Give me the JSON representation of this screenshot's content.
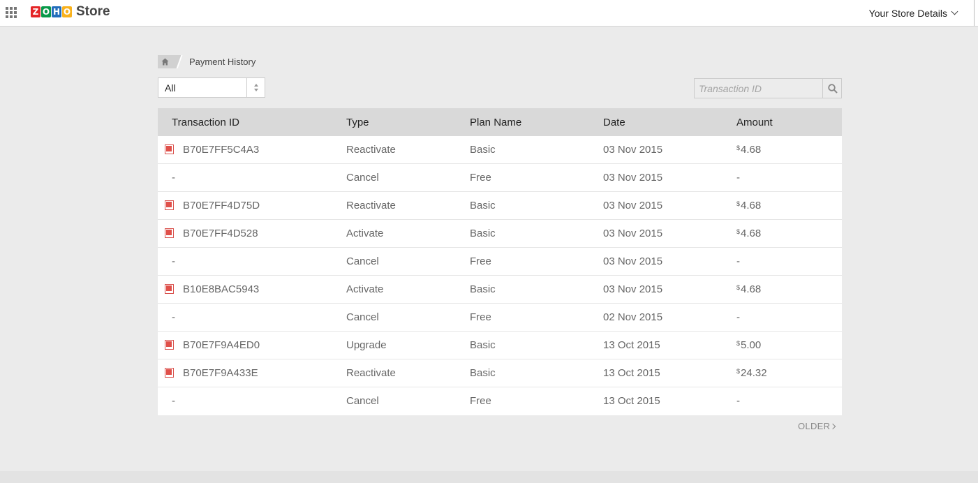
{
  "header": {
    "logo_letters": [
      "Z",
      "O",
      "H",
      "O"
    ],
    "logo_colors": [
      "#e42527",
      "#089949",
      "#226dbb",
      "#f9b21d"
    ],
    "app_name": "Store",
    "store_menu_label": "Your Store Details"
  },
  "breadcrumb": {
    "current": "Payment History"
  },
  "filter": {
    "selected": "All"
  },
  "search": {
    "placeholder": "Transaction ID"
  },
  "table": {
    "columns": [
      "Transaction ID",
      "Type",
      "Plan Name",
      "Date",
      "Amount"
    ],
    "rows": [
      {
        "id": "B70E7FF5C4A3",
        "type": "Reactivate",
        "plan": "Basic",
        "date": "03 Nov 2015",
        "currency": "$",
        "amount": "4.68",
        "has_pdf": true
      },
      {
        "id": "-",
        "type": "Cancel",
        "plan": "Free",
        "date": "03 Nov 2015",
        "currency": "",
        "amount": "-",
        "has_pdf": false
      },
      {
        "id": "B70E7FF4D75D",
        "type": "Reactivate",
        "plan": "Basic",
        "date": "03 Nov 2015",
        "currency": "$",
        "amount": "4.68",
        "has_pdf": true
      },
      {
        "id": "B70E7FF4D528",
        "type": "Activate",
        "plan": "Basic",
        "date": "03 Nov 2015",
        "currency": "$",
        "amount": "4.68",
        "has_pdf": true
      },
      {
        "id": "-",
        "type": "Cancel",
        "plan": "Free",
        "date": "03 Nov 2015",
        "currency": "",
        "amount": "-",
        "has_pdf": false
      },
      {
        "id": "B10E8BAC5943",
        "type": "Activate",
        "plan": "Basic",
        "date": "03 Nov 2015",
        "currency": "$",
        "amount": "4.68",
        "has_pdf": true
      },
      {
        "id": "-",
        "type": "Cancel",
        "plan": "Free",
        "date": "02 Nov 2015",
        "currency": "",
        "amount": "-",
        "has_pdf": false
      },
      {
        "id": "B70E7F9A4ED0",
        "type": "Upgrade",
        "plan": "Basic",
        "date": "13 Oct 2015",
        "currency": "$",
        "amount": "5.00",
        "has_pdf": true
      },
      {
        "id": "B70E7F9A433E",
        "type": "Reactivate",
        "plan": "Basic",
        "date": "13 Oct 2015",
        "currency": "$",
        "amount": "24.32",
        "has_pdf": true
      },
      {
        "id": "-",
        "type": "Cancel",
        "plan": "Free",
        "date": "13 Oct 2015",
        "currency": "",
        "amount": "-",
        "has_pdf": false
      }
    ]
  },
  "pagination": {
    "older_label": "OLDER"
  },
  "icons": {
    "apps": "apps-grid-icon",
    "home": "home-icon",
    "search": "search-icon",
    "pdf": "pdf-icon",
    "chevron": "chevron-down-icon"
  }
}
